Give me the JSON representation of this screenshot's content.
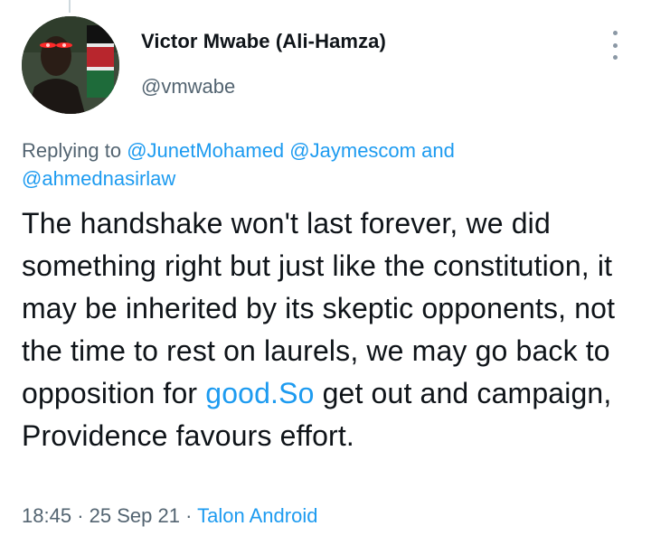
{
  "author": {
    "name": "Victor Mwabe (Ali-Hamza)",
    "handle": "@vmwabe"
  },
  "reply_context": {
    "prefix": "Replying to ",
    "mention1": "@JunetMohamed",
    "mention2": "@Jaymescom",
    "conjunction": "and",
    "mention3": "@ahmednasirlaw"
  },
  "tweet": {
    "text_before_link": "The handshake won't last forever, we did something right but just like the constitution, it may be inherited by its skeptic opponents, not the time to rest on laurels, we may go back to opposition for ",
    "link_text": "good.So",
    "text_after_link": " get out and campaign, Providence favours effort."
  },
  "meta": {
    "time": "18:45",
    "date": "25 Sep 21",
    "separator": "·",
    "source": "Talon Android"
  },
  "icons": {
    "more": "more-vertical-icon"
  },
  "colors": {
    "link": "#1d9bf0",
    "secondary_text": "#536471",
    "primary_text": "#0f1419"
  }
}
